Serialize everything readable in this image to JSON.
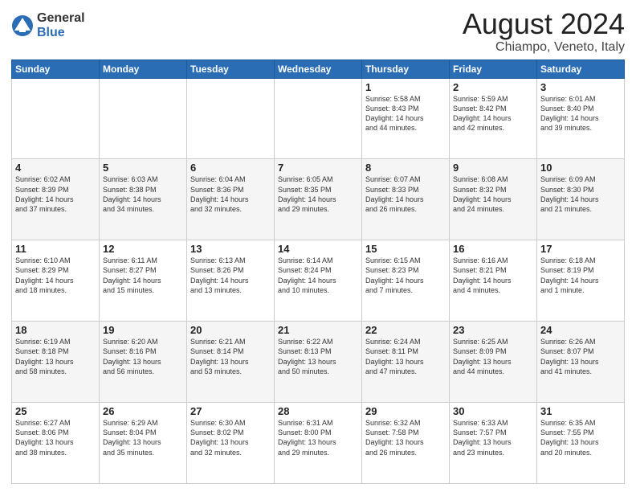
{
  "logo": {
    "general": "General",
    "blue": "Blue"
  },
  "title": "August 2024",
  "location": "Chiampo, Veneto, Italy",
  "weekdays": [
    "Sunday",
    "Monday",
    "Tuesday",
    "Wednesday",
    "Thursday",
    "Friday",
    "Saturday"
  ],
  "weeks": [
    [
      {
        "day": "",
        "info": ""
      },
      {
        "day": "",
        "info": ""
      },
      {
        "day": "",
        "info": ""
      },
      {
        "day": "",
        "info": ""
      },
      {
        "day": "1",
        "info": "Sunrise: 5:58 AM\nSunset: 8:43 PM\nDaylight: 14 hours\nand 44 minutes."
      },
      {
        "day": "2",
        "info": "Sunrise: 5:59 AM\nSunset: 8:42 PM\nDaylight: 14 hours\nand 42 minutes."
      },
      {
        "day": "3",
        "info": "Sunrise: 6:01 AM\nSunset: 8:40 PM\nDaylight: 14 hours\nand 39 minutes."
      }
    ],
    [
      {
        "day": "4",
        "info": "Sunrise: 6:02 AM\nSunset: 8:39 PM\nDaylight: 14 hours\nand 37 minutes."
      },
      {
        "day": "5",
        "info": "Sunrise: 6:03 AM\nSunset: 8:38 PM\nDaylight: 14 hours\nand 34 minutes."
      },
      {
        "day": "6",
        "info": "Sunrise: 6:04 AM\nSunset: 8:36 PM\nDaylight: 14 hours\nand 32 minutes."
      },
      {
        "day": "7",
        "info": "Sunrise: 6:05 AM\nSunset: 8:35 PM\nDaylight: 14 hours\nand 29 minutes."
      },
      {
        "day": "8",
        "info": "Sunrise: 6:07 AM\nSunset: 8:33 PM\nDaylight: 14 hours\nand 26 minutes."
      },
      {
        "day": "9",
        "info": "Sunrise: 6:08 AM\nSunset: 8:32 PM\nDaylight: 14 hours\nand 24 minutes."
      },
      {
        "day": "10",
        "info": "Sunrise: 6:09 AM\nSunset: 8:30 PM\nDaylight: 14 hours\nand 21 minutes."
      }
    ],
    [
      {
        "day": "11",
        "info": "Sunrise: 6:10 AM\nSunset: 8:29 PM\nDaylight: 14 hours\nand 18 minutes."
      },
      {
        "day": "12",
        "info": "Sunrise: 6:11 AM\nSunset: 8:27 PM\nDaylight: 14 hours\nand 15 minutes."
      },
      {
        "day": "13",
        "info": "Sunrise: 6:13 AM\nSunset: 8:26 PM\nDaylight: 14 hours\nand 13 minutes."
      },
      {
        "day": "14",
        "info": "Sunrise: 6:14 AM\nSunset: 8:24 PM\nDaylight: 14 hours\nand 10 minutes."
      },
      {
        "day": "15",
        "info": "Sunrise: 6:15 AM\nSunset: 8:23 PM\nDaylight: 14 hours\nand 7 minutes."
      },
      {
        "day": "16",
        "info": "Sunrise: 6:16 AM\nSunset: 8:21 PM\nDaylight: 14 hours\nand 4 minutes."
      },
      {
        "day": "17",
        "info": "Sunrise: 6:18 AM\nSunset: 8:19 PM\nDaylight: 14 hours\nand 1 minute."
      }
    ],
    [
      {
        "day": "18",
        "info": "Sunrise: 6:19 AM\nSunset: 8:18 PM\nDaylight: 13 hours\nand 58 minutes."
      },
      {
        "day": "19",
        "info": "Sunrise: 6:20 AM\nSunset: 8:16 PM\nDaylight: 13 hours\nand 56 minutes."
      },
      {
        "day": "20",
        "info": "Sunrise: 6:21 AM\nSunset: 8:14 PM\nDaylight: 13 hours\nand 53 minutes."
      },
      {
        "day": "21",
        "info": "Sunrise: 6:22 AM\nSunset: 8:13 PM\nDaylight: 13 hours\nand 50 minutes."
      },
      {
        "day": "22",
        "info": "Sunrise: 6:24 AM\nSunset: 8:11 PM\nDaylight: 13 hours\nand 47 minutes."
      },
      {
        "day": "23",
        "info": "Sunrise: 6:25 AM\nSunset: 8:09 PM\nDaylight: 13 hours\nand 44 minutes."
      },
      {
        "day": "24",
        "info": "Sunrise: 6:26 AM\nSunset: 8:07 PM\nDaylight: 13 hours\nand 41 minutes."
      }
    ],
    [
      {
        "day": "25",
        "info": "Sunrise: 6:27 AM\nSunset: 8:06 PM\nDaylight: 13 hours\nand 38 minutes."
      },
      {
        "day": "26",
        "info": "Sunrise: 6:29 AM\nSunset: 8:04 PM\nDaylight: 13 hours\nand 35 minutes."
      },
      {
        "day": "27",
        "info": "Sunrise: 6:30 AM\nSunset: 8:02 PM\nDaylight: 13 hours\nand 32 minutes."
      },
      {
        "day": "28",
        "info": "Sunrise: 6:31 AM\nSunset: 8:00 PM\nDaylight: 13 hours\nand 29 minutes."
      },
      {
        "day": "29",
        "info": "Sunrise: 6:32 AM\nSunset: 7:58 PM\nDaylight: 13 hours\nand 26 minutes."
      },
      {
        "day": "30",
        "info": "Sunrise: 6:33 AM\nSunset: 7:57 PM\nDaylight: 13 hours\nand 23 minutes."
      },
      {
        "day": "31",
        "info": "Sunrise: 6:35 AM\nSunset: 7:55 PM\nDaylight: 13 hours\nand 20 minutes."
      }
    ]
  ]
}
